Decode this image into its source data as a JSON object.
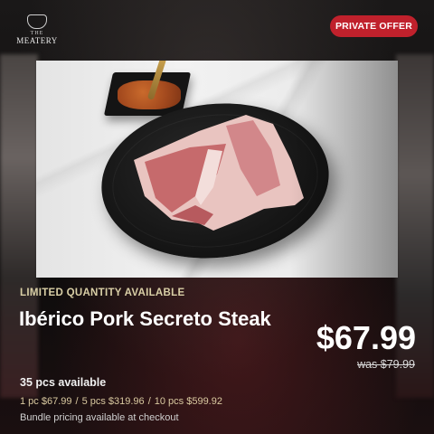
{
  "brand": {
    "top": "THE",
    "name": "MEATERY"
  },
  "badge": {
    "label": "PRIVATE OFFER",
    "color": "#c0212c"
  },
  "promo": {
    "tagline": "LIMITED QUANTITY AVAILABLE"
  },
  "product": {
    "title": "Ibérico Pork Secreto Steak",
    "price": "$67.99",
    "was_price": "was $79.99",
    "availability": "35 pcs available",
    "bundle_tiers": [
      "1 pc $67.99",
      "5 pcs $319.96",
      "10 pcs $599.92"
    ],
    "tier_separator": "/",
    "bundle_note": "Bundle pricing available at checkout"
  },
  "colors": {
    "accent_gold": "#d9cfa6",
    "badge_red": "#c0212c"
  }
}
